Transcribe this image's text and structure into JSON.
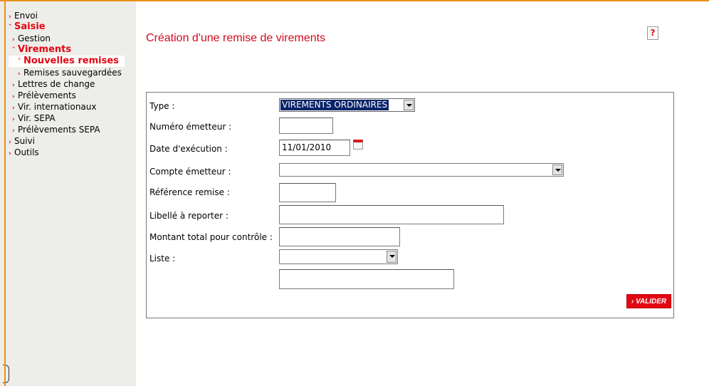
{
  "sidebar": {
    "items": [
      {
        "label": "Envoi"
      },
      {
        "label": "Saisie"
      },
      {
        "label": "Gestion"
      },
      {
        "label": "Virements"
      },
      {
        "label": "Nouvelles remises"
      },
      {
        "label": "Remises sauvegardées"
      },
      {
        "label": "Lettres de change"
      },
      {
        "label": "Prélèvements"
      },
      {
        "label": "Vir. internationaux"
      },
      {
        "label": "Vir. SEPA"
      },
      {
        "label": "Prélèvements SEPA"
      },
      {
        "label": "Suivi"
      },
      {
        "label": "Outils"
      }
    ]
  },
  "page": {
    "title": "Création d'une remise de virements",
    "help_symbol": "?"
  },
  "form": {
    "type_label": "Type :",
    "type_value": "VIREMENTS ORDINAIRES",
    "numero_label": "Numéro émetteur :",
    "numero_value": "",
    "date_label": "Date d'exécution :",
    "date_value": "11/01/2010",
    "compte_label": "Compte émetteur :",
    "compte_value": "",
    "reference_label": "Référence remise :",
    "reference_value": "",
    "libelle_label": "Libellé à reporter :",
    "libelle_value": "",
    "montant_label": "Montant total pour contrôle :",
    "montant_value": "",
    "liste_label": "Liste :",
    "liste_value": "",
    "liste_extra_value": "",
    "submit_label": "VALIDER"
  },
  "colors": {
    "accent": "#e30613",
    "title": "#d20a1e",
    "border_top": "#e8921a",
    "sidebar_bg": "#edede9"
  }
}
